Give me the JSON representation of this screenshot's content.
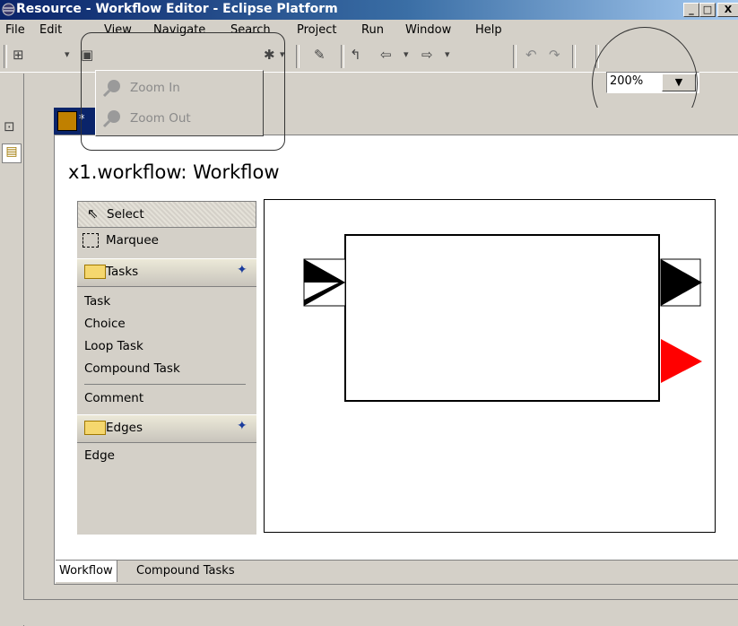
{
  "window": {
    "title": "Resource - Workflow Editor - Eclipse Platform",
    "min_label": "_",
    "max_label": "□",
    "close_label": "X"
  },
  "menu": {
    "items": [
      "File",
      "Edit",
      "View",
      "Navigate",
      "Search",
      "Project",
      "Run",
      "Window",
      "Help"
    ]
  },
  "view_menu": {
    "items": [
      "Zoom In",
      "Zoom Out"
    ]
  },
  "toolbar": {
    "zoom_value": "200%"
  },
  "editor": {
    "tab_label": "*",
    "title": "x1.workflow: Workflow"
  },
  "palette": {
    "tools": [
      "Select",
      "Marquee"
    ],
    "tasks_drawer": "Tasks",
    "task_items": [
      "Task",
      "Choice",
      "Loop Task",
      "Compound Task",
      "Comment"
    ],
    "edges_drawer": "Edges",
    "edge_items": [
      "Edge"
    ]
  },
  "bottom_tabs": [
    "Workflow",
    "Compound Tasks"
  ],
  "colors": {
    "title_bar": "#0a246a",
    "port_red": "#ff0000",
    "port_black": "#000000"
  }
}
